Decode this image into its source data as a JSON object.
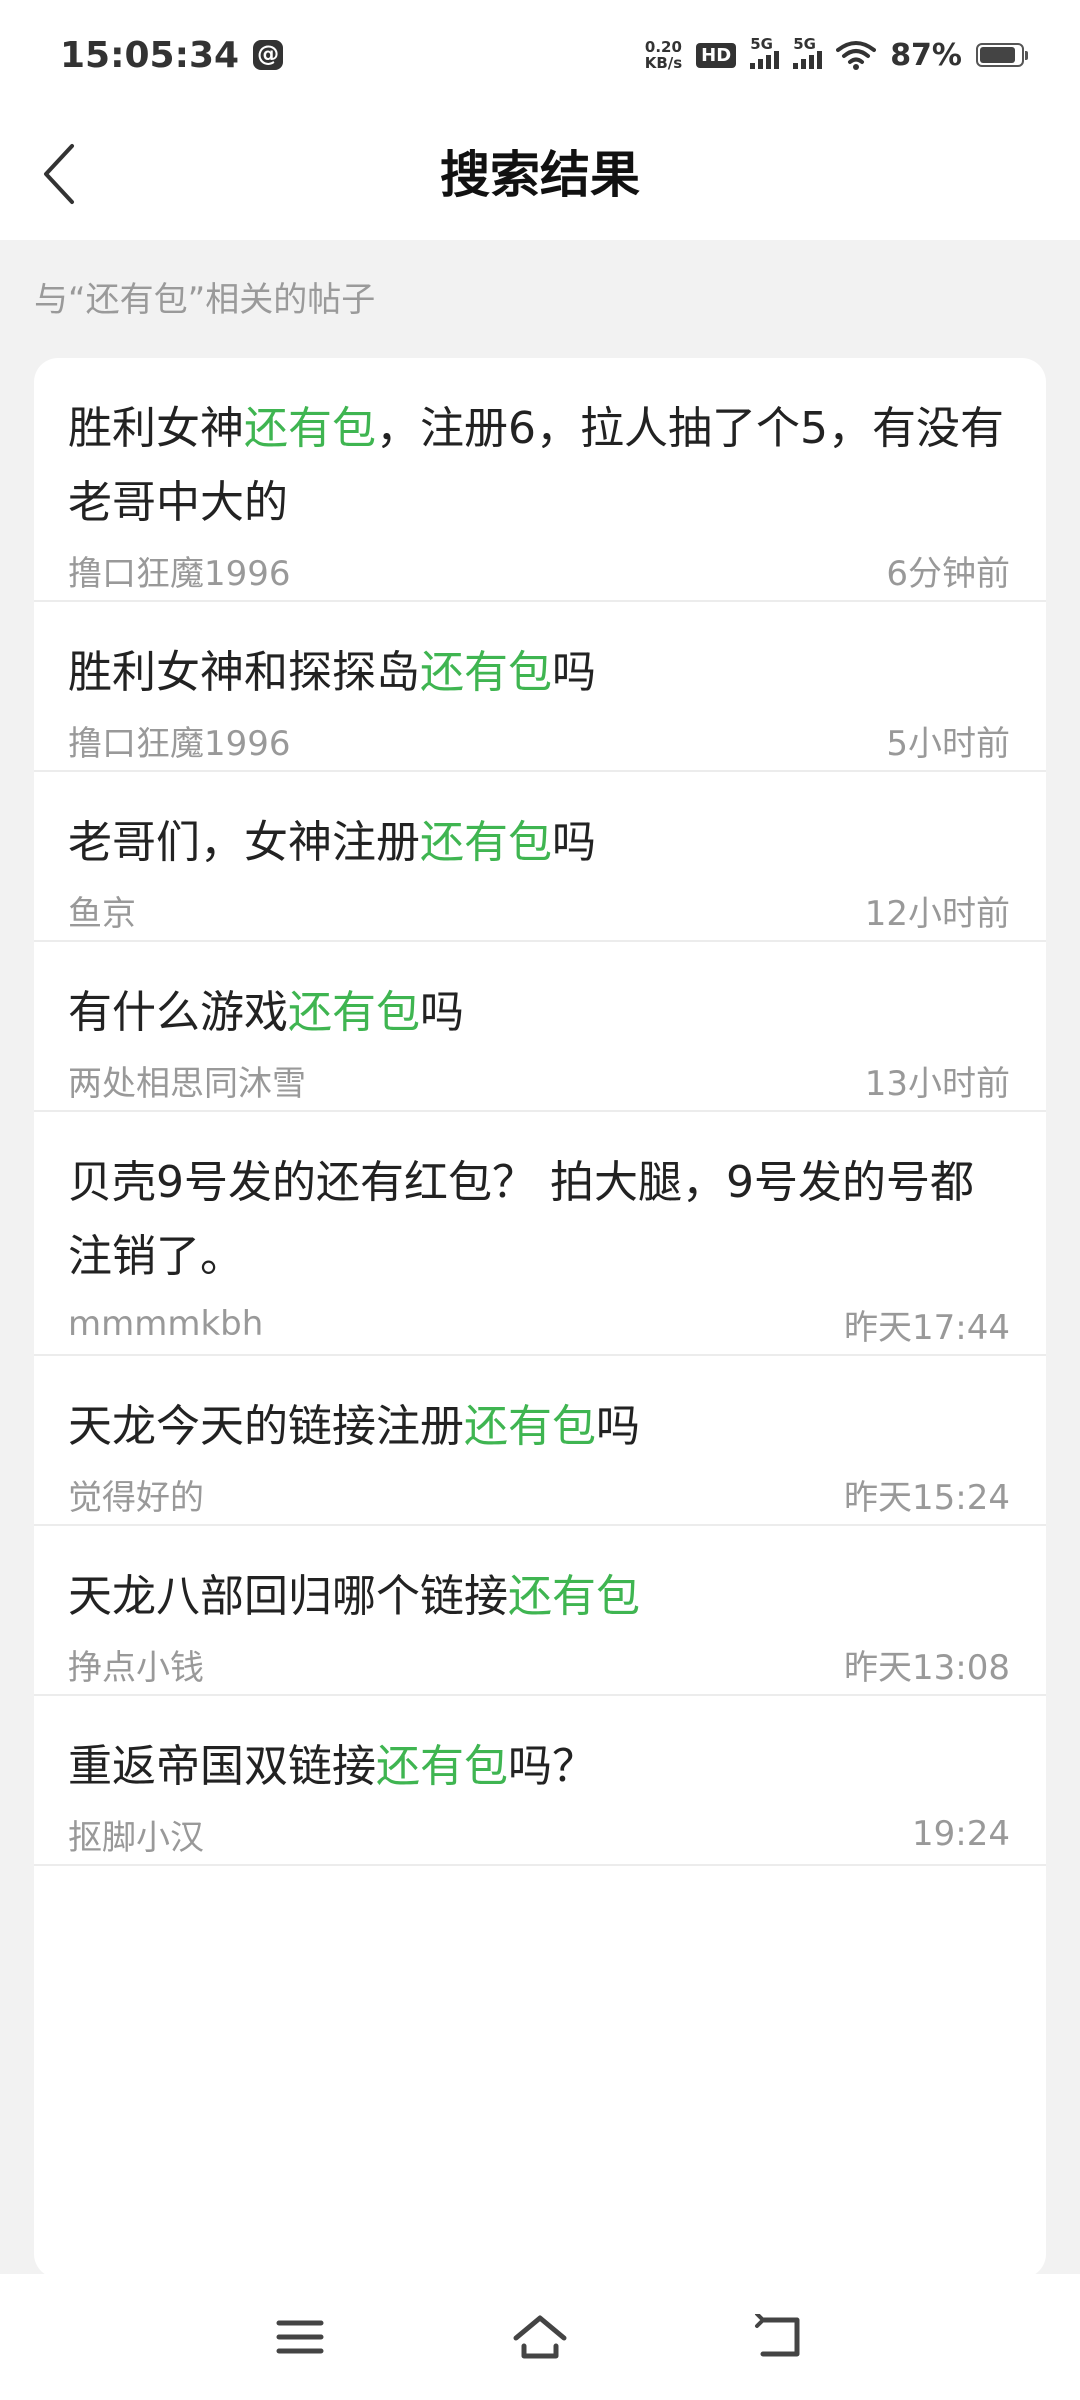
{
  "status_bar": {
    "time": "15:05:34",
    "speed_value": "0.20",
    "speed_unit": "KB/s",
    "hd_label": "HD",
    "sim1_label": "5G",
    "sim2_label": "5G",
    "battery_text": "87%",
    "battery_level": 0.87,
    "icons": [
      "at-icon",
      "hd-icon",
      "signal-icon",
      "signal-icon",
      "wifi-icon",
      "battery-icon"
    ]
  },
  "header": {
    "title": "搜索结果",
    "back_icon": "chevron-left-icon"
  },
  "section_label": "与“还有包”相关的帖子",
  "highlight_color": "#3fb551",
  "posts": [
    {
      "parts": [
        "胜利女神",
        "还有包",
        "，注册6，拉人抽了个5，有没有老哥中大的"
      ],
      "author": "撸口狂魔1996",
      "time": "6分钟前"
    },
    {
      "parts": [
        "胜利女神和探探岛",
        "还有包",
        "吗"
      ],
      "author": "撸口狂魔1996",
      "time": "5小时前"
    },
    {
      "parts": [
        "老哥们，女神注册",
        "还有包",
        "吗"
      ],
      "author": "鱼京",
      "time": "12小时前"
    },
    {
      "parts": [
        "有什么游戏",
        "还有包",
        "吗"
      ],
      "author": "两处相思同沐雪",
      "time": "13小时前"
    },
    {
      "parts": [
        "贝壳9号发的还有红包？ 拍大腿，9号发的号都注销了。",
        "",
        ""
      ],
      "author": "mmmmkbh",
      "time": "昨天17:44"
    },
    {
      "parts": [
        "天龙今天的链接注册",
        "还有包",
        "吗"
      ],
      "author": "觉得好的",
      "time": "昨天15:24"
    },
    {
      "parts": [
        "天龙八部回归哪个链接",
        "还有包",
        ""
      ],
      "author": "挣点小钱",
      "time": "昨天13:08"
    },
    {
      "parts": [
        "重返帝国双链接",
        "还有包",
        "吗？"
      ],
      "author": "抠脚小汉",
      "time": "19:24"
    }
  ],
  "nav_bar": {
    "icons": [
      "menu-icon",
      "home-icon",
      "back-icon"
    ]
  }
}
